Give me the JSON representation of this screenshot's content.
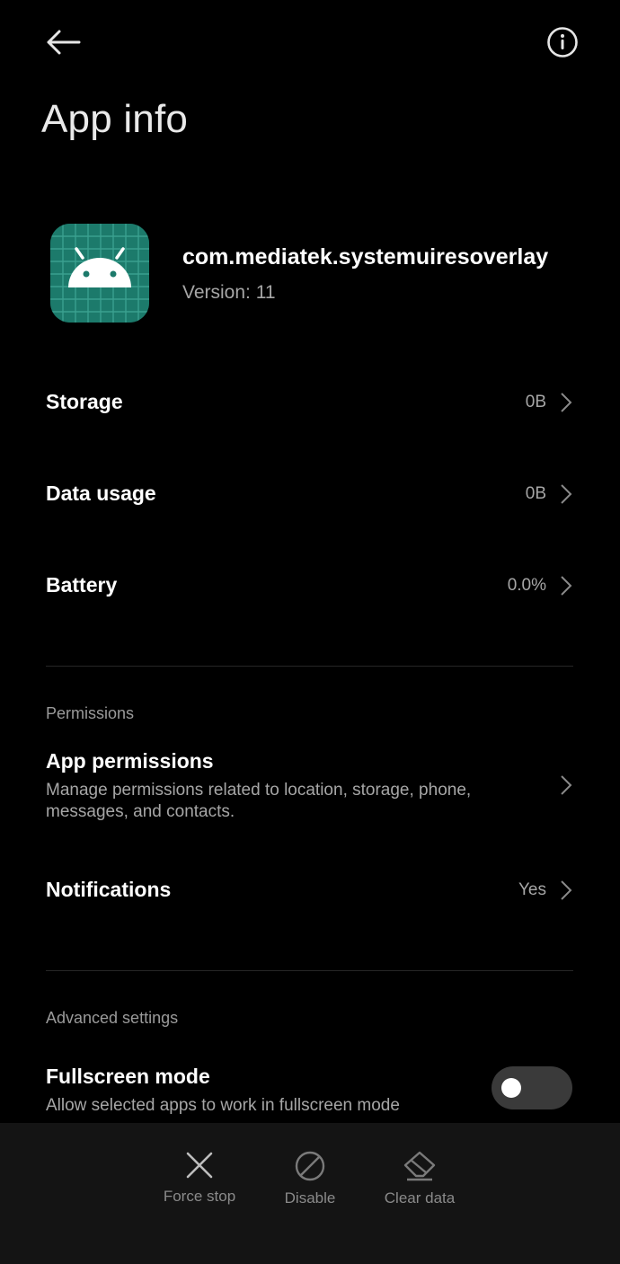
{
  "header": {
    "title": "App info"
  },
  "app": {
    "name": "com.mediatek.systemuiresoverlay",
    "version": "Version: 11",
    "icon_color": "#1c7a6b"
  },
  "rows": {
    "storage": {
      "label": "Storage",
      "value": "0B"
    },
    "data_usage": {
      "label": "Data usage",
      "value": "0B"
    },
    "battery": {
      "label": "Battery",
      "value": "0.0%"
    }
  },
  "permissions": {
    "section_label": "Permissions",
    "app_permissions_label": "App permissions",
    "app_permissions_desc": "Manage permissions related to location, storage, phone, messages, and contacts.",
    "notifications_label": "Notifications",
    "notifications_value": "Yes"
  },
  "advanced": {
    "section_label": "Advanced settings",
    "fullscreen_label": "Fullscreen mode",
    "fullscreen_desc": "Allow selected apps to work in fullscreen mode",
    "fullscreen_enabled": false
  },
  "actions": {
    "force_stop": "Force stop",
    "disable": "Disable",
    "clear_data": "Clear data"
  }
}
